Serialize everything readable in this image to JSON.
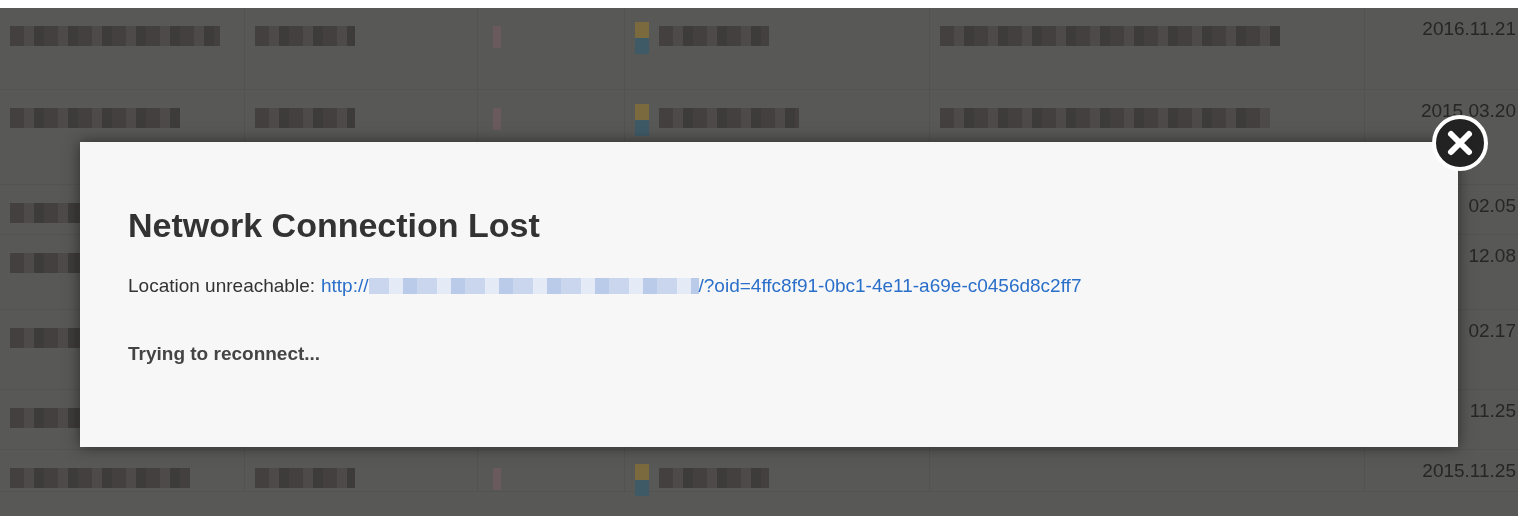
{
  "table": {
    "rows": [
      {
        "date": "2016.11.21"
      },
      {
        "date": "2015.03.20"
      },
      {
        "date": "02.05"
      },
      {
        "date": "12.08"
      },
      {
        "date": "02.17"
      },
      {
        "date": "11.25"
      },
      {
        "date": "2015.11.25"
      }
    ]
  },
  "dialog": {
    "title": "Network Connection Lost",
    "message_label": "Location unreachable:",
    "link_start": "http://",
    "link_end": "/?oid=4ffc8f91-0bc1-4e11-a69e-c0456d8c2ff7",
    "status": "Trying to reconnect..."
  }
}
